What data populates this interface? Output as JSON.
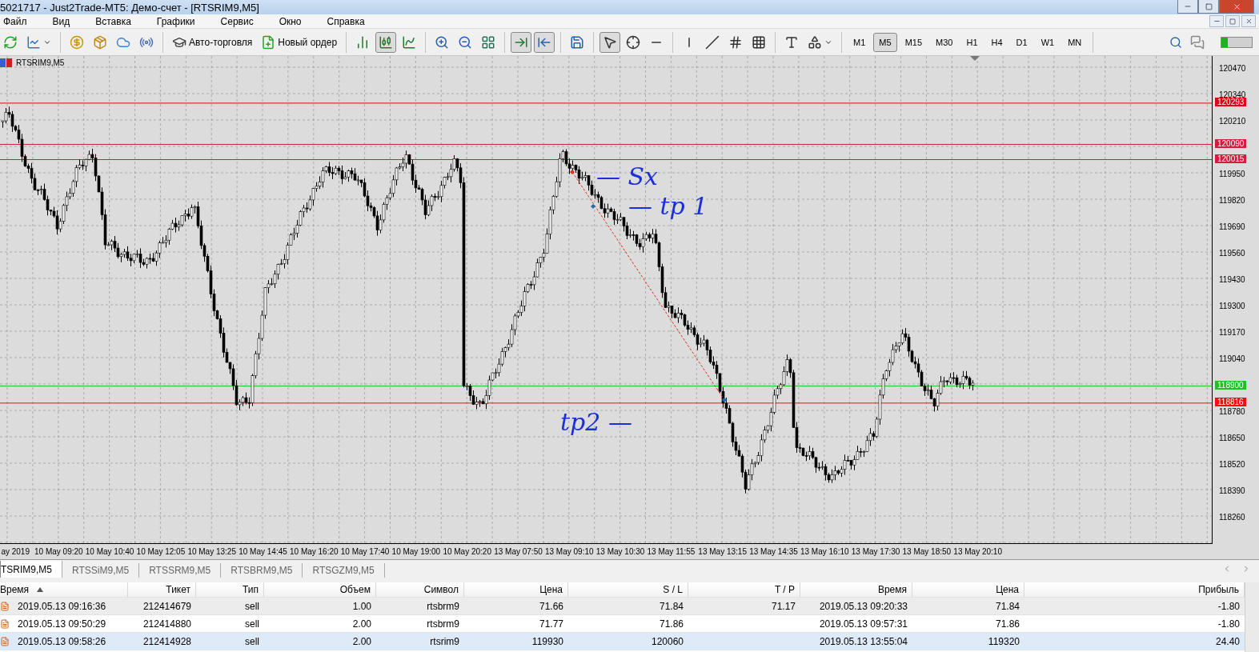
{
  "window": {
    "title": "5021717 - Just2Trade-MT5: Демо-счет - [RTSRIM9,M5]"
  },
  "menu": [
    "Файл",
    "Вид",
    "Вставка",
    "Графики",
    "Сервис",
    "Окно",
    "Справка"
  ],
  "toolbar": [
    {
      "kind": "icon",
      "selected": false
    },
    {
      "kind": "icon",
      "selected": false
    },
    {
      "kind": "icon",
      "selected": false
    },
    {
      "kind": "icon",
      "selected": false
    },
    {
      "kind": "icon",
      "selected": false
    },
    {
      "kind": "icon",
      "selected": false
    },
    {
      "kind": "text",
      "label": "Авто-торговля",
      "selected": false
    },
    {
      "kind": "text",
      "label": "Новый ордер",
      "selected": false
    },
    {
      "kind": "icon",
      "selected": false
    },
    {
      "kind": "icon",
      "selected": true
    },
    {
      "kind": "icon",
      "selected": false
    },
    {
      "kind": "icon",
      "selected": false
    },
    {
      "kind": "icon",
      "selected": false
    },
    {
      "kind": "icon",
      "selected": false
    },
    {
      "kind": "icon",
      "selected": true
    },
    {
      "kind": "icon",
      "selected": true
    },
    {
      "kind": "icon",
      "selected": false
    },
    {
      "kind": "icon",
      "selected": true
    },
    {
      "kind": "icon",
      "selected": false
    },
    {
      "kind": "icon",
      "selected": false
    },
    {
      "kind": "icon",
      "selected": false
    },
    {
      "kind": "icon",
      "selected": false
    },
    {
      "kind": "icon",
      "selected": false
    },
    {
      "kind": "icon",
      "selected": false
    },
    {
      "kind": "icon",
      "selected": false
    },
    {
      "kind": "icon",
      "selected": false
    }
  ],
  "timeframes": [
    {
      "label": "M1",
      "selected": false
    },
    {
      "label": "M5",
      "selected": true
    },
    {
      "label": "M15",
      "selected": false
    },
    {
      "label": "M30",
      "selected": false
    },
    {
      "label": "H1",
      "selected": false
    },
    {
      "label": "H4",
      "selected": false
    },
    {
      "label": "D1",
      "selected": false
    },
    {
      "label": "W1",
      "selected": false
    },
    {
      "label": "MN",
      "selected": false
    }
  ],
  "chart": {
    "symbol": "RTSRIM9,M5",
    "price_ticks": [
      "120470",
      "120340",
      "120210",
      "119950",
      "119820",
      "119690",
      "119560",
      "119430",
      "119300",
      "119170",
      "119040",
      "118780",
      "118650",
      "118520",
      "118390",
      "118260"
    ],
    "levels": [
      {
        "price": "120293",
        "color": "#e60012"
      },
      {
        "price": "120090",
        "color": "#d81b3c"
      },
      {
        "price": "120015",
        "color": "#d81b3c"
      },
      {
        "price": "118900",
        "color": "#1ec21e"
      },
      {
        "price": "118816",
        "color": "#f01010"
      }
    ],
    "time_ticks": [
      "ay 2019",
      "10 May 09:20",
      "10 May 10:40",
      "10 May 12:05",
      "10 May 13:25",
      "10 May 14:45",
      "10 May 16:20",
      "10 May 17:40",
      "10 May 19:00",
      "10 May 20:20",
      "13 May 07:50",
      "13 May 09:10",
      "13 May 10:30",
      "13 May 11:55",
      "13 May 13:15",
      "13 May 14:35",
      "13 May 16:10",
      "13 May 17:30",
      "13 May 18:50",
      "13 May 20:10"
    ],
    "annotations": [
      "— Sx",
      "— tp 1",
      "tp2 —"
    ]
  },
  "tabs": [
    {
      "label": "TSRIM9,M5",
      "selected": true
    },
    {
      "label": "RTSSiM9,M5",
      "selected": false
    },
    {
      "label": "RTSSRM9,M5",
      "selected": false
    },
    {
      "label": "RTSBRM9,M5",
      "selected": false
    },
    {
      "label": "RTSGZM9,M5",
      "selected": false
    }
  ],
  "table": {
    "columns": [
      {
        "label": "Время",
        "sorted": true
      },
      {
        "label": "Тикет",
        "sorted": false
      },
      {
        "label": "Тип",
        "sorted": false
      },
      {
        "label": "Объем",
        "sorted": false
      },
      {
        "label": "Символ",
        "sorted": false
      },
      {
        "label": "Цена",
        "sorted": false
      },
      {
        "label": "S / L",
        "sorted": false
      },
      {
        "label": "T / P",
        "sorted": false
      },
      {
        "label": "Время",
        "sorted": false
      },
      {
        "label": "Цена",
        "sorted": false
      },
      {
        "label": "Прибыль",
        "sorted": false
      }
    ],
    "rows": [
      {
        "selected": false,
        "highlighted": true,
        "cells": [
          "2019.05.13 09:16:36",
          "212414679",
          "sell",
          "1.00",
          "rtsbrm9",
          "71.66",
          "71.84",
          "71.17",
          "2019.05.13 09:20:33",
          "71.84",
          "-1.80"
        ]
      },
      {
        "selected": false,
        "highlighted": false,
        "cells": [
          "2019.05.13 09:50:29",
          "212414880",
          "sell",
          "2.00",
          "rtsbrm9",
          "71.77",
          "71.86",
          "",
          "2019.05.13 09:57:31",
          "71.86",
          "-1.80"
        ]
      },
      {
        "selected": true,
        "highlighted": false,
        "cells": [
          "2019.05.13 09:58:26",
          "212414928",
          "sell",
          "2.00",
          "rtsrim9",
          "119930",
          "120060",
          "",
          "2019.05.13 13:55:04",
          "119320",
          "24.40"
        ]
      }
    ]
  }
}
